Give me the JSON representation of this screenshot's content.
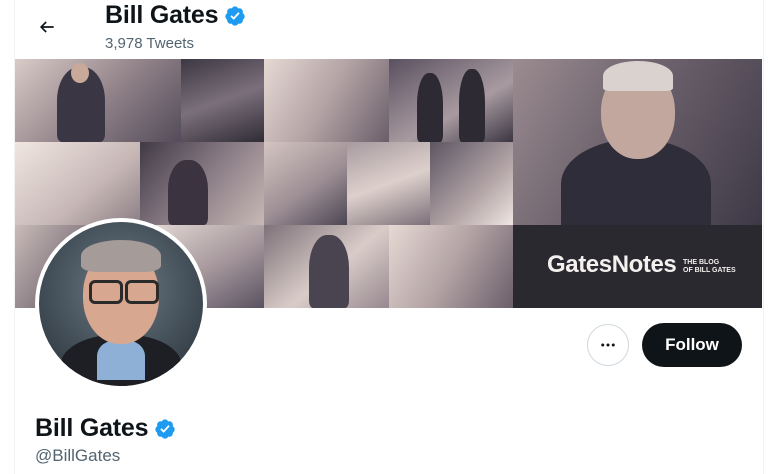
{
  "header": {
    "name": "Bill Gates",
    "tweet_count": "3,978 Tweets"
  },
  "banner": {
    "brand": "GatesNotes",
    "tagline_line1": "THE BLOG",
    "tagline_line2": "OF BILL GATES"
  },
  "profile": {
    "name": "Bill Gates",
    "handle": "@BillGates"
  },
  "actions": {
    "follow_label": "Follow",
    "more_icon": "more-horizontal-icon"
  },
  "colors": {
    "verified": "#1d9bf0",
    "follow_bg": "#0f1419",
    "secondary_text": "#536471"
  }
}
